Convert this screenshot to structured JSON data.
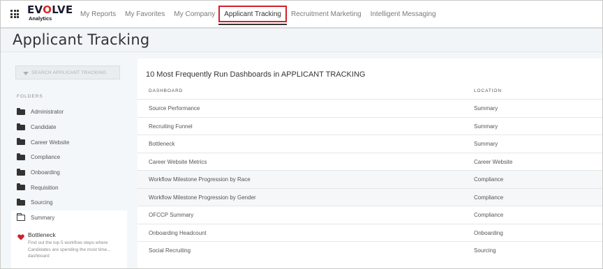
{
  "brand": {
    "name_pre": "EV",
    "name_accent": "O",
    "name_post": "LVE",
    "sub": "Analytics"
  },
  "nav": {
    "items": [
      {
        "label": "My Reports"
      },
      {
        "label": "My Favorites"
      },
      {
        "label": "My Company"
      },
      {
        "label": "Applicant Tracking"
      },
      {
        "label": "Recruitment Marketing"
      },
      {
        "label": "Intelligent Messaging"
      }
    ],
    "active_index": 3,
    "active_highlight_color": "#d21f2a"
  },
  "page": {
    "title": "Applicant Tracking"
  },
  "sidebar": {
    "search_placeholder": "SEARCH APPLICANT TRACKING",
    "folders_label": "FOLDERS",
    "folders": [
      {
        "label": "Administrator",
        "icon": "folder-icon"
      },
      {
        "label": "Candidate",
        "icon": "folder-icon"
      },
      {
        "label": "Career Website",
        "icon": "folder-icon"
      },
      {
        "label": "Compliance",
        "icon": "folder-icon"
      },
      {
        "label": "Onboarding",
        "icon": "folder-icon"
      },
      {
        "label": "Requisition",
        "icon": "folder-icon"
      },
      {
        "label": "Sourcing",
        "icon": "folder-icon"
      },
      {
        "label": "Summary",
        "icon": "folder-open-outline-icon"
      }
    ],
    "selected_folder": "Summary",
    "favorite": {
      "icon": "heart-icon",
      "icon_color": "#d21f2a",
      "title": "Bottleneck",
      "description": "Find out the top 5 workflow steps where Candidates are spending the most time... dashboard"
    }
  },
  "main": {
    "title": "10 Most Frequently Run Dashboards in APPLICANT TRACKING",
    "columns": {
      "dashboard": "DASHBOARD",
      "location": "LOCATION"
    },
    "rows": [
      {
        "dashboard": "Source Performance",
        "location": "Summary"
      },
      {
        "dashboard": "Recruiting Funnel",
        "location": "Summary"
      },
      {
        "dashboard": "Bottleneck",
        "location": "Summary"
      },
      {
        "dashboard": "Career Website Metrics",
        "location": "Career Website"
      },
      {
        "dashboard": "Workflow Milestone Progression by Race",
        "location": "Compliance"
      },
      {
        "dashboard": "Workflow Milestone Progression by Gender",
        "location": "Compliance"
      },
      {
        "dashboard": "OFCCP Summary",
        "location": "Compliance"
      },
      {
        "dashboard": "Onboarding Headcount",
        "location": "Onboarding"
      },
      {
        "dashboard": "Social Recruiting",
        "location": "Sourcing"
      }
    ]
  }
}
